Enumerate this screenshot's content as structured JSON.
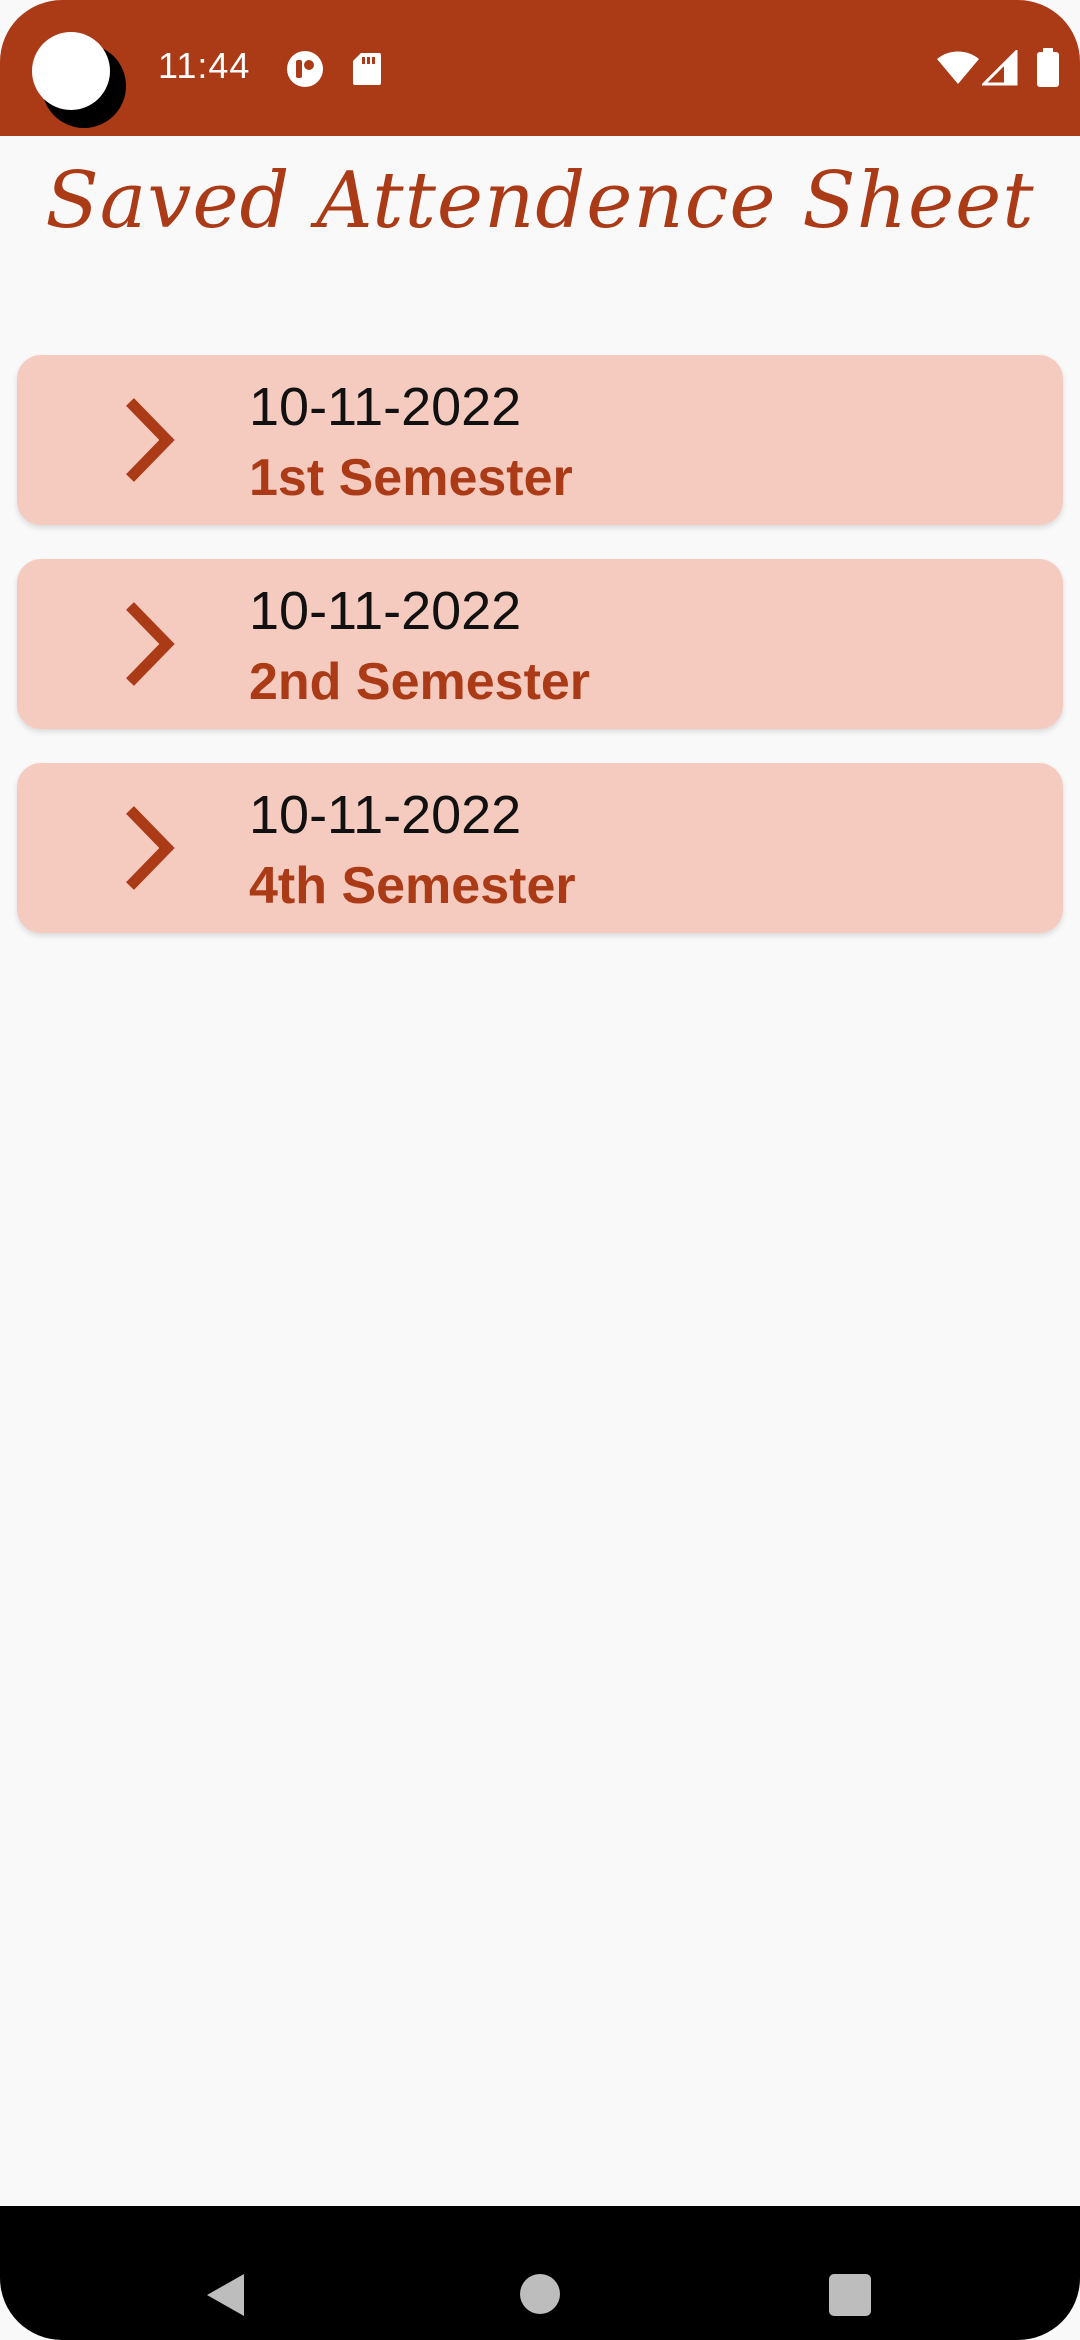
{
  "status_bar": {
    "time": "11:44",
    "icons": [
      "camera-punch-hole-icon",
      "app-notification-icon",
      "sd-card-icon",
      "wifi-icon",
      "signal-icon",
      "battery-icon"
    ],
    "background": "#ab3a17"
  },
  "title": "Saved Attendence Sheet",
  "sheets": [
    {
      "date": "10-11-2022",
      "semester": "1st Semester"
    },
    {
      "date": "10-11-2022",
      "semester": "2nd Semester"
    },
    {
      "date": "10-11-2022",
      "semester": "4th Semester"
    }
  ],
  "colors": {
    "accent": "#ab3a17",
    "card_background": "#f6cbbf",
    "page_background": "#f9f9f9"
  },
  "nav_bar": {
    "icons": [
      "back-icon",
      "home-icon",
      "recents-icon"
    ]
  }
}
